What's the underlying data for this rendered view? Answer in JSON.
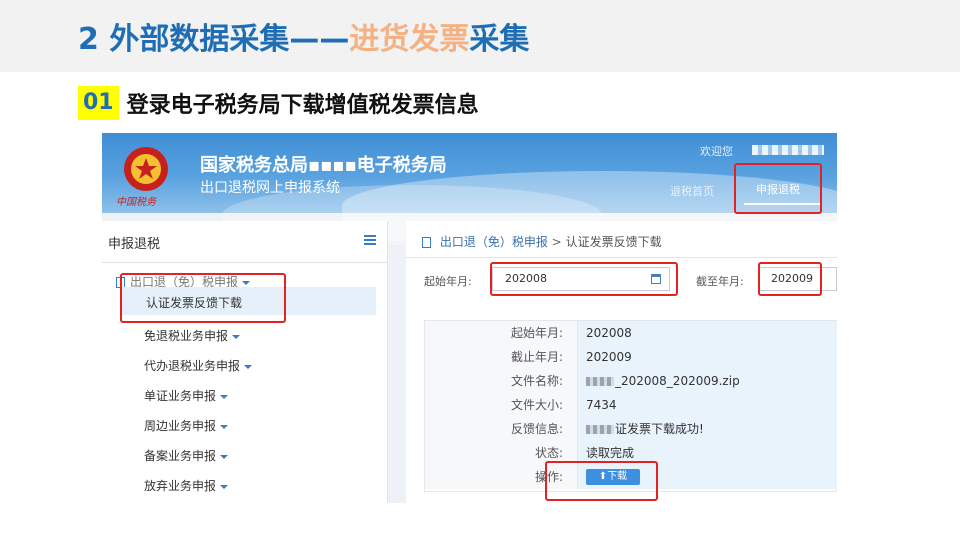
{
  "slide": {
    "title_prefix": "2 外部数据采集——",
    "title_accent": "进货发票",
    "title_suffix": "采集",
    "step_number": "01",
    "step_text": "登录电子税务局下载增值税发票信息"
  },
  "portal": {
    "agency_name": "国家税务总局▪▪▪▪电子税务局",
    "system_name": "出口退税网上申报系统",
    "emblem_caption": "中国税务",
    "welcome": "欢迎您",
    "nav": {
      "home": "退税首页",
      "refund": "申报退税"
    }
  },
  "sidebar": {
    "title": "申报退税",
    "group": "出口退（免）税申报",
    "active_item": "认证发票反馈下载",
    "items": [
      "免退税业务申报",
      "代办退税业务申报",
      "单证业务申报",
      "周边业务申报",
      "备案业务申报",
      "放弃业务申报"
    ]
  },
  "breadcrumb": {
    "root": "出口退（免）税申报",
    "separator": ">",
    "current": "认证发票反馈下载"
  },
  "form": {
    "start_label": "起始年月:",
    "start_value": "202008",
    "end_label": "截至年月:",
    "end_value": "202009"
  },
  "details": {
    "start_label": "起始年月:",
    "start_value": "202008",
    "end_label": "截止年月:",
    "end_value": "202009",
    "file_name_label": "文件名称:",
    "file_name_value": "_202008_202009.zip",
    "file_size_label": "文件大小:",
    "file_size_value": "7434",
    "feedback_label": "反馈信息:",
    "feedback_value": "证发票下载成功!",
    "status_label": "状态:",
    "status_value": "读取完成",
    "action_label": "操作:",
    "download_label": "下载"
  },
  "colors": {
    "title_blue": "#1f6db5",
    "title_accent": "#f4b183",
    "highlight_red": "#e32222",
    "badge_yellow": "#ffff00",
    "button_blue": "#3d8fe0"
  }
}
